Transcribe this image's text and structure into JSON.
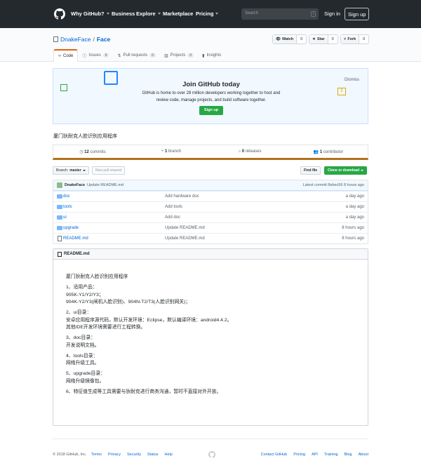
{
  "header": {
    "nav": [
      {
        "label": "Why GitHub?",
        "caret": true
      },
      {
        "label": "Business",
        "caret": false
      },
      {
        "label": "Explore",
        "caret": true
      },
      {
        "label": "Marketplace",
        "caret": false
      },
      {
        "label": "Pricing",
        "caret": true
      }
    ],
    "search_placeholder": "Search",
    "search_shortcut": "/",
    "signin": "Sign in",
    "signup": "Sign up"
  },
  "repo": {
    "owner": "DnakeFace",
    "separator": "/",
    "name": "Face",
    "watch": {
      "label": "Watch",
      "count": "0"
    },
    "star": {
      "label": "Star",
      "count": "0"
    },
    "fork": {
      "label": "Fork",
      "count": "0"
    },
    "tabs": [
      {
        "label": "Code",
        "counter": ""
      },
      {
        "label": "Issues",
        "counter": "0"
      },
      {
        "label": "Pull requests",
        "counter": "0"
      },
      {
        "label": "Projects",
        "counter": "0"
      },
      {
        "label": "Insights",
        "counter": ""
      }
    ],
    "description": "厦门狄耐克人脸识别应用程序"
  },
  "banner": {
    "title": "Join GitHub today",
    "text": "GitHub is home to over 28 million developers working together to host and review code, manage projects, and build software together.",
    "button": "Sign up",
    "dismiss": "Dismiss"
  },
  "summary": {
    "commits_num": "12",
    "commits_label": "commits",
    "branch_num": "1",
    "branch_label": "branch",
    "releases_num": "0",
    "releases_label": "releases",
    "contributors_num": "1",
    "contributors_label": "contributor"
  },
  "filenav": {
    "branch_label": "Branch:",
    "branch": "master",
    "new_pr": "New pull request",
    "find_file": "Find file",
    "clone": "Clone or download"
  },
  "commit": {
    "author": "DnakeFace",
    "message": "Update README.md",
    "latest": "Latest commit 8ebec56 8 hours ago"
  },
  "files": [
    {
      "name": "doc",
      "type": "dir",
      "message": "Add hardware doc",
      "age": "a day ago"
    },
    {
      "name": "tools",
      "type": "dir",
      "message": "Add tools",
      "age": "a day ago"
    },
    {
      "name": "ui",
      "type": "dir",
      "message": "Add doc",
      "age": "a day ago"
    },
    {
      "name": "upgrade",
      "type": "dir",
      "message": "Update README.md",
      "age": "8 hours ago"
    },
    {
      "name": "README.md",
      "type": "file",
      "message": "Update README.md",
      "age": "8 hours ago"
    }
  ],
  "readme": {
    "title": "README.md",
    "lines": [
      [
        "厦门狄耐克人脸识别应用程序"
      ],
      [
        "1、适用产品：",
        "905K-Y1/Y2/Y3；",
        "904K-Y2/Y3(闸机人脸识别)、904N-T2/T3(人脸识别网关)；"
      ],
      [
        "2、ui目录：",
        "安卓应用程序源代码，默认开发环境：Eclipse，默认编译环境：android4.4.2。",
        "其他IDE开发环境需要进行工程转换。"
      ],
      [
        "3、doc目录：",
        "开发说明文档。"
      ],
      [
        "4、tools目录：",
        "网络升级工具。"
      ],
      [
        "5、upgrade目录：",
        "网络升级镜像包。"
      ],
      [
        "6、特征值生成等工具需要与狄耐克进行商务沟通，暂时不直接对外开放。"
      ]
    ]
  },
  "footer": {
    "copyright": "© 2018 GitHub, Inc.",
    "left_links": [
      "Terms",
      "Privacy",
      "Security",
      "Status",
      "Help"
    ],
    "right_links": [
      "Contact GitHub",
      "Pricing",
      "API",
      "Training",
      "Blog",
      "About"
    ]
  },
  "colors": {
    "header_bg": "#24292e",
    "link": "#0366d6",
    "green": "#28a745",
    "lang_bar": "#b07219",
    "tab_accent": "#e36209"
  }
}
